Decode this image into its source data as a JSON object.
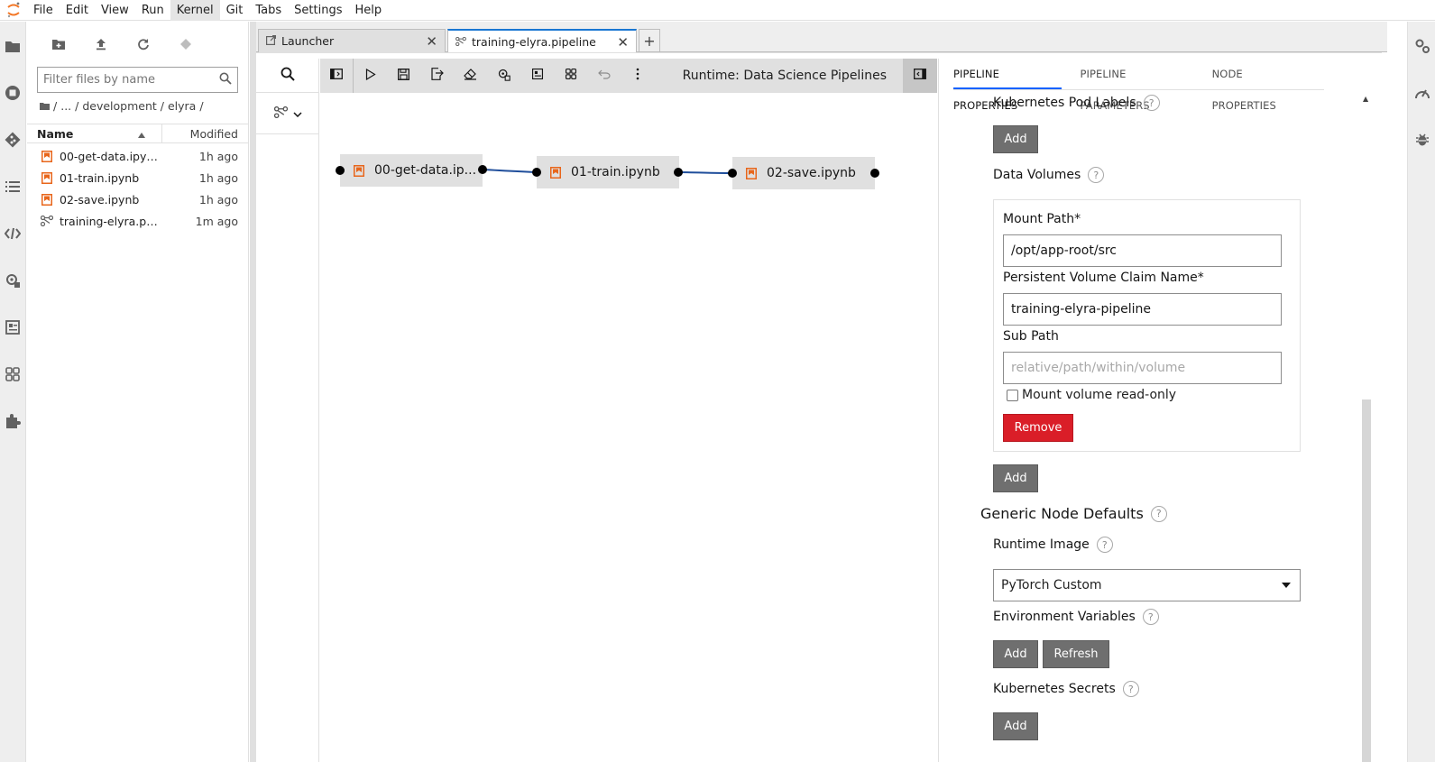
{
  "menu": {
    "items": [
      "File",
      "Edit",
      "View",
      "Run",
      "Kernel",
      "Git",
      "Tabs",
      "Settings",
      "Help"
    ],
    "active": "Kernel"
  },
  "filebrowser": {
    "filter_placeholder": "Filter files by name",
    "breadcrumb": [
      "/",
      "...",
      "/ development",
      "/ elyra",
      "/"
    ],
    "columns": {
      "name": "Name",
      "modified": "Modified"
    },
    "files": [
      {
        "name": "00-get-data.ipynb",
        "modified": "1h ago",
        "icon": "notebook-icon"
      },
      {
        "name": "01-train.ipynb",
        "modified": "1h ago",
        "icon": "notebook-icon"
      },
      {
        "name": "02-save.ipynb",
        "modified": "1h ago",
        "icon": "notebook-icon"
      },
      {
        "name": "training-elyra.pip...",
        "modified": "1m ago",
        "icon": "pipeline-icon"
      }
    ]
  },
  "tabs": [
    {
      "label": "Launcher",
      "active": false
    },
    {
      "label": "training-elyra.pipeline",
      "active": true
    }
  ],
  "canvas": {
    "runtime_label": "Runtime: Data Science Pipelines",
    "nodes": [
      {
        "label": "00-get-data.ip..."
      },
      {
        "label": "01-train.ipynb"
      },
      {
        "label": "02-save.ipynb"
      }
    ]
  },
  "properties": {
    "tabs": [
      "PIPELINE PROPERTIES",
      "PIPELINE PARAMETERS",
      "NODE PROPERTIES"
    ],
    "k8s_pod_labels": "Kubernetes Pod Labels",
    "add": "Add",
    "data_volumes": "Data Volumes",
    "mount_path_label": "Mount Path*",
    "mount_path_value": "/opt/app-root/src",
    "pvc_label": "Persistent Volume Claim Name*",
    "pvc_value": "training-elyra-pipeline",
    "sub_path_label": "Sub Path",
    "sub_path_placeholder": "relative/path/within/volume",
    "readonly_label": "Mount volume read-only",
    "remove": "Remove",
    "generic_defaults": "Generic Node Defaults",
    "runtime_image_label": "Runtime Image",
    "runtime_image_value": "PyTorch Custom",
    "env_vars": "Environment Variables",
    "refresh": "Refresh",
    "k8s_secrets": "Kubernetes Secrets",
    "help_glyph": "?"
  },
  "colors": {
    "notebook_orange": "#e8661b",
    "edge_blue": "#1f4e9b",
    "remove_red": "#da1e28",
    "active_tab_blue": "#0f62fe"
  }
}
